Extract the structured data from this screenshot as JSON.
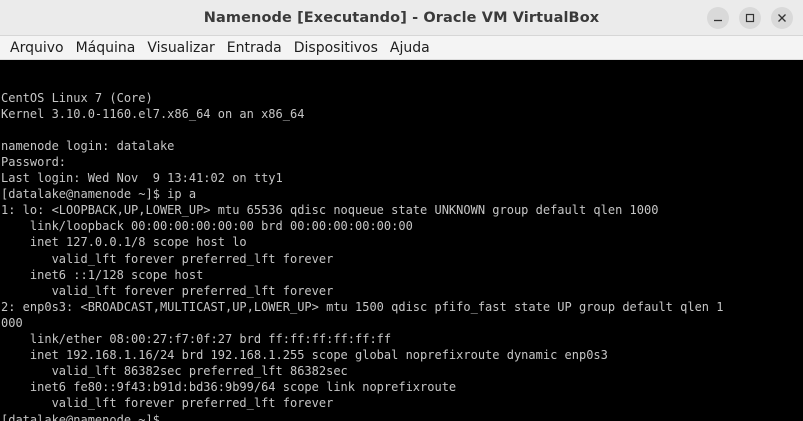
{
  "window": {
    "title": "Namenode [Executando] - Oracle VM VirtualBox",
    "ghost_title_fragment": "...oracle ..."
  },
  "controls": {
    "minimize_icon": "minimize-icon",
    "maximize_icon": "maximize-icon",
    "close_icon": "close-icon"
  },
  "menu": {
    "items": [
      "Arquivo",
      "Máquina",
      "Visualizar",
      "Entrada",
      "Dispositivos",
      "Ajuda"
    ]
  },
  "console": {
    "lines": [
      "",
      "CentOS Linux 7 (Core)",
      "Kernel 3.10.0-1160.el7.x86_64 on an x86_64",
      "",
      "namenode login: datalake",
      "Password:",
      "Last login: Wed Nov  9 13:41:02 on tty1",
      "[datalake@namenode ~]$ ip a",
      "1: lo: <LOOPBACK,UP,LOWER_UP> mtu 65536 qdisc noqueue state UNKNOWN group default qlen 1000",
      "    link/loopback 00:00:00:00:00:00 brd 00:00:00:00:00:00",
      "    inet 127.0.0.1/8 scope host lo",
      "       valid_lft forever preferred_lft forever",
      "    inet6 ::1/128 scope host",
      "       valid_lft forever preferred_lft forever",
      "2: enp0s3: <BROADCAST,MULTICAST,UP,LOWER_UP> mtu 1500 qdisc pfifo_fast state UP group default qlen 1",
      "000",
      "    link/ether 08:00:27:f7:0f:27 brd ff:ff:ff:ff:ff:ff",
      "    inet 192.168.1.16/24 brd 192.168.1.255 scope global noprefixroute dynamic enp0s3",
      "       valid_lft 86382sec preferred_lft 86382sec",
      "    inet6 fe80::9f43:b91d:bd36:9b99/64 scope link noprefixroute",
      "       valid_lft forever preferred_lft forever"
    ],
    "prompt": "[datalake@namenode ~]$ "
  },
  "colors": {
    "terminal_bg": "#000000",
    "terminal_fg": "#c6c6c6",
    "titlebar_bg": "#ebebeb",
    "menubar_bg": "#f4f4f4"
  }
}
